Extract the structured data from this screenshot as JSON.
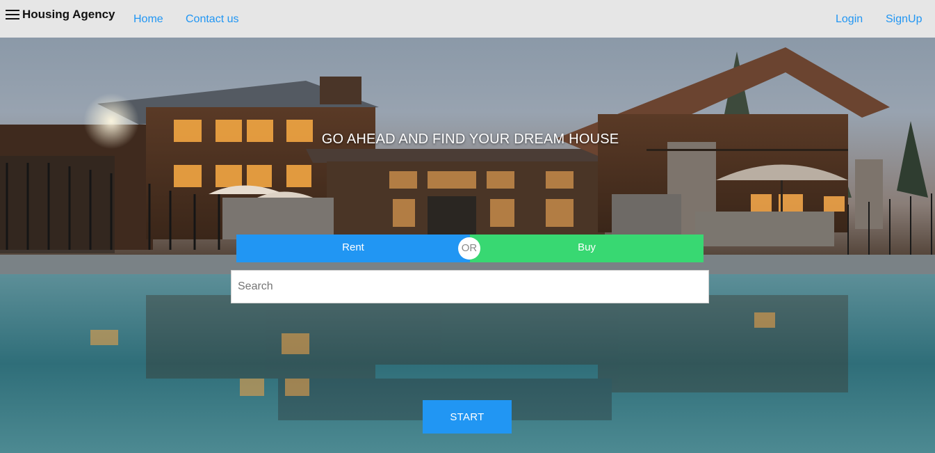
{
  "navbar": {
    "menu_icon": "hamburger-menu-icon",
    "brand": "Housing Agency",
    "links": {
      "home": "Home",
      "contact": "Contact us",
      "login": "Login",
      "signup": "SignUp"
    }
  },
  "hero": {
    "headline": "GO AHEAD AND FIND YOUR DREAM HOUSE",
    "toggle": {
      "rent_label": "Rent",
      "or_label": "OR",
      "buy_label": "Buy"
    },
    "search": {
      "placeholder": "Search",
      "value": ""
    },
    "start_label": "START"
  },
  "colors": {
    "navbar_bg": "#e6e6e6",
    "link": "#2196f3",
    "rent": "#2196f3",
    "buy": "#38d872",
    "start": "#2196f3"
  }
}
